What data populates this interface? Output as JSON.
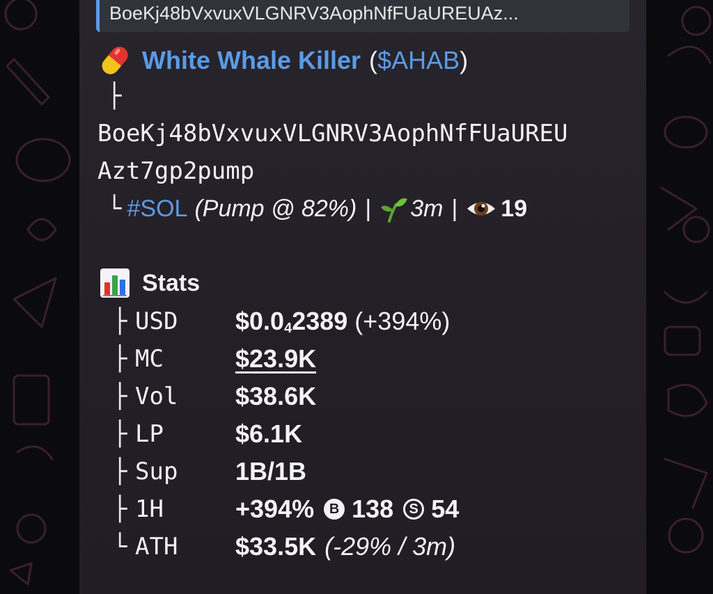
{
  "quote": {
    "text": "BoeKj48bVxvuxVLGNRV3AophNfFUaUREUAz..."
  },
  "token": {
    "name": "White Whale Killer",
    "open_paren": "(",
    "ticker": "$AHAB",
    "close_paren": ")",
    "tree_branch": "├",
    "contract_line1": "BoeKj48bVxvuxVLGNRV3AophNfFUaUREU",
    "contract_line2": "Azt7gp2pump",
    "corner": "└",
    "chain_tag": "#SOL",
    "pump_status": "(Pump @ 82%)",
    "separator": "|",
    "age": "3m",
    "views": "19"
  },
  "stats": {
    "heading": "Stats",
    "rows": [
      {
        "branch": "├",
        "key": "USD",
        "value_main": "$0.0",
        "value_sub": "4",
        "value_rest": "2389",
        "value_extra": "(+394%)"
      },
      {
        "branch": "├",
        "key": "MC",
        "value": "$23.9K"
      },
      {
        "branch": "├",
        "key": "Vol",
        "value": "$38.6K"
      },
      {
        "branch": "├",
        "key": "LP",
        "value": "$6.1K"
      },
      {
        "branch": "├",
        "key": "Sup",
        "value": "1B/1B"
      },
      {
        "branch": "├",
        "key": "1H",
        "value": "+394%",
        "buy_icon": "B",
        "buys": "138",
        "sell_icon": "S",
        "sells": "54"
      },
      {
        "branch": "└",
        "key": "ATH",
        "value": "$33.5K",
        "value_extra": "(-29% / 3m)"
      }
    ]
  },
  "colors": {
    "link": "#5b9be6",
    "bubble": "#241f27",
    "background": "#0b0b0d",
    "quote_bar": "#5b9be6"
  },
  "icons": [
    "pill-icon",
    "seedling-icon",
    "eye-icon",
    "bar-chart-icon",
    "buy-coin-icon",
    "sell-coin-icon"
  ]
}
